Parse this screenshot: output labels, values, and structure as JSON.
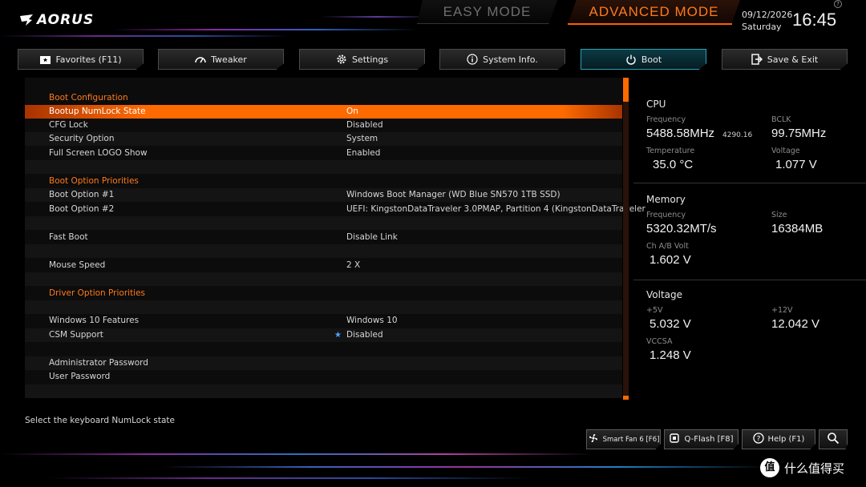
{
  "brand": {
    "logo_text": "AORUS"
  },
  "modes": {
    "easy": "EASY MODE",
    "advanced": "ADVANCED MODE"
  },
  "datetime": {
    "date": "09/12/2026",
    "day": "Saturday",
    "time": "16:45"
  },
  "tabs": [
    {
      "label": "Favorites (F11)",
      "icon": "folder-star-icon"
    },
    {
      "label": "Tweaker",
      "icon": "gauge-icon"
    },
    {
      "label": "Settings",
      "icon": "gear-icon"
    },
    {
      "label": "System Info.",
      "icon": "info-icon"
    },
    {
      "label": "Boot",
      "icon": "power-icon",
      "active": true
    },
    {
      "label": "Save & Exit",
      "icon": "exit-icon"
    }
  ],
  "boot": {
    "header_config": "Boot Configuration",
    "numlock": {
      "label": "Bootup NumLock State",
      "value": "On"
    },
    "cfg_lock": {
      "label": "CFG Lock",
      "value": "Disabled"
    },
    "security": {
      "label": "Security Option",
      "value": "System"
    },
    "logo_show": {
      "label": "Full Screen LOGO Show",
      "value": "Enabled"
    },
    "header_priorities": "Boot Option Priorities",
    "boot1": {
      "label": "Boot Option #1",
      "value": "Windows Boot Manager (WD Blue SN570 1TB SSD)"
    },
    "boot2": {
      "label": "Boot Option #2",
      "value": "UEFI: KingstonDataTraveler 3.0PMAP, Partition 4 (KingstonDataTraveler"
    },
    "fast_boot": {
      "label": "Fast Boot",
      "value": "Disable Link"
    },
    "mouse_speed": {
      "label": "Mouse Speed",
      "value": "2 X"
    },
    "header_driver": "Driver Option Priorities",
    "win10": {
      "label": "Windows 10 Features",
      "value": "Windows 10"
    },
    "csm": {
      "label": "CSM Support",
      "value": "Disabled"
    },
    "admin_pw": {
      "label": "Administrator Password"
    },
    "user_pw": {
      "label": "User Password"
    }
  },
  "status": {
    "cpu": {
      "title": "CPU",
      "freq_label": "Frequency",
      "freq_value": "5488.58MHz",
      "freq_sub": "4290.16",
      "bclk_label": "BCLK",
      "bclk_value": "99.75MHz",
      "temp_label": "Temperature",
      "temp_value": "35.0 °C",
      "volt_label": "Voltage",
      "volt_value": "1.077 V"
    },
    "memory": {
      "title": "Memory",
      "freq_label": "Frequency",
      "freq_value": "5320.32MT/s",
      "size_label": "Size",
      "size_value": "16384MB",
      "volt_label": "Ch A/B Volt",
      "volt_value": "1.602 V"
    },
    "voltage": {
      "title": "Voltage",
      "v5_label": "+5V",
      "v5_value": "5.032 V",
      "v12_label": "+12V",
      "v12_value": "12.042 V",
      "vccsa_label": "VCCSA",
      "vccsa_value": "1.248 V"
    }
  },
  "help_text": "Select the keyboard NumLock state",
  "bottom": {
    "smartfan": "Smart Fan 6 [F6]",
    "qflash": "Q-Flash [F8]",
    "help": "Help (F1)"
  },
  "watermark": {
    "badge": "值",
    "text": "什么值得买"
  },
  "colors": {
    "accent": "#ff6a00",
    "active_tab": "#2aa3b5",
    "header_text": "#ff7a1a"
  }
}
